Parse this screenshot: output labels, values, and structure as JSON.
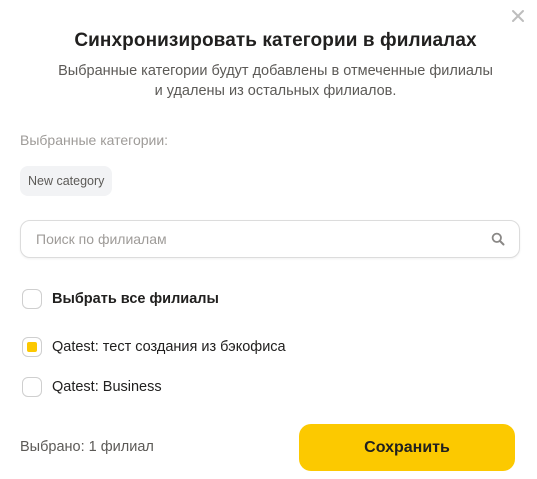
{
  "dialog": {
    "title": "Синхронизировать категории в филиалах",
    "subtitle_line1": "Выбранные категории будут добавлены в отмеченные филиалы",
    "subtitle_line2": "и удалены из остальных филиалов.",
    "close_icon": "close-icon"
  },
  "selected_categories": {
    "label": "Выбранные категории:",
    "chips": [
      "New category"
    ]
  },
  "search": {
    "placeholder": "Поиск по филиалам",
    "value": "",
    "icon": "search-icon"
  },
  "select_all": {
    "label": "Выбрать все филиалы",
    "checked": false
  },
  "branches": [
    {
      "label": "Qatest: тест создания из бэкофиса",
      "checked": true
    },
    {
      "label": "Qatest: Business",
      "checked": false
    }
  ],
  "footer": {
    "selected_count_text": "Выбрано: 1 филиал",
    "save_label": "Сохранить"
  },
  "colors": {
    "accent": "#fcc900",
    "text_primary": "#21201f",
    "text_secondary": "#5c5a57",
    "text_muted": "#9e9b98"
  }
}
